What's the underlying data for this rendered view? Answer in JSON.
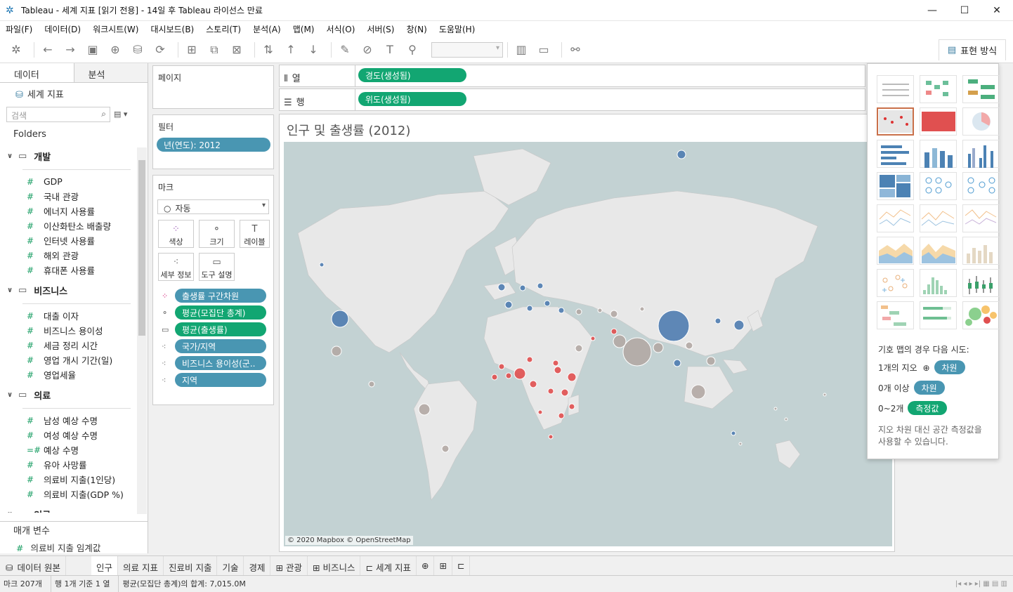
{
  "window": {
    "title": "Tableau - 세계 지표 [읽기 전용] - 14일 후 Tableau 라이선스 만료",
    "minimize": "—",
    "maximize": "☐",
    "close": "✕"
  },
  "menu": [
    "파일(F)",
    "데이터(D)",
    "워크시트(W)",
    "대시보드(B)",
    "스토리(T)",
    "분석(A)",
    "맵(M)",
    "서식(O)",
    "서버(S)",
    "창(N)",
    "도움말(H)"
  ],
  "toolbar": {
    "show_me_label": "표현 방식"
  },
  "data_pane": {
    "tab_data": "데이터",
    "tab_analysis": "분석",
    "datasource": "세계 지표",
    "search_placeholder": "검색",
    "folders_label": "Folders",
    "groups": [
      {
        "name": "개발",
        "fields": [
          "GDP",
          "국내 관광",
          "에너지 사용률",
          "이산화탄소 배출량",
          "인터넷 사용률",
          "해외 관광",
          "휴대폰 사용률"
        ]
      },
      {
        "name": "비즈니스",
        "fields": [
          "대출 이자",
          "비즈니스 용이성",
          "세금 정리 시간",
          "영업 개시 기간(일)",
          "영업세율"
        ]
      },
      {
        "name": "의료",
        "fields": [
          "남성 예상 수명",
          "여성 예상 수명",
          "예상 수명",
          "유아 사망률",
          "의료비 지출(1인당)",
          "의료비 지출(GDP %)"
        ]
      },
      {
        "name": "인구",
        "fields": []
      }
    ],
    "params_label": "매개 변수",
    "params": [
      "의료비 지출 임계값"
    ]
  },
  "pages": {
    "title": "페이지"
  },
  "filters": {
    "title": "필터",
    "items": [
      "년(연도): 2012"
    ]
  },
  "marks": {
    "title": "마크",
    "type": "자동",
    "buttons": {
      "color": "색상",
      "size": "크기",
      "label": "레이블",
      "detail": "세부 정보",
      "tooltip": "도구 설명"
    },
    "pills": [
      "출생률 구간차원",
      "평균(모집단 총계)",
      "평균(출생률)",
      "국가/지역",
      "비즈니스 용이성(군..",
      "지역"
    ]
  },
  "shelves": {
    "columns_label": "열",
    "columns_pill": "경도(생성됨)",
    "rows_label": "행",
    "rows_pill": "위도(생성됨)"
  },
  "viz": {
    "title": "인구 및 출생률 (2012)",
    "attribution": "© 2020 Mapbox © OpenStreetMap"
  },
  "showme": {
    "hint_title": "기호 맵의 경우 다음 시도:",
    "req1": "1개의 지오",
    "req1_pill": "차원",
    "req2": "0개 이상",
    "req2_pill": "차원",
    "req3": "0~2개",
    "req3_pill": "측정값",
    "note1": "지오 차원 대신 공간 측정값을",
    "note2": "사용할 수 있습니다."
  },
  "sheet_tabs": [
    "데이터 원본",
    "인구",
    "의료 지표",
    "진료비 지출",
    "기술",
    "경제",
    "관광",
    "비즈니스",
    "세계 지표"
  ],
  "status": {
    "marks": "마크 207개",
    "rows": "행 1개 기준 1 열",
    "sum": "평균(모집단 총계)의 합계: 7,015.0M"
  },
  "colors": {
    "blue": "#4f7cb0",
    "gray": "#b2a8a4",
    "red": "#e04f4f",
    "pill_blue": "#4996b2",
    "pill_green": "#12a672"
  }
}
